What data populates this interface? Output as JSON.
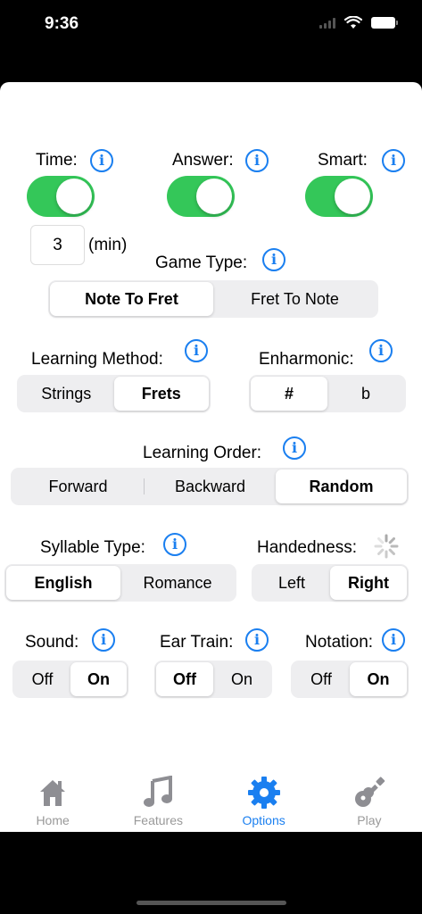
{
  "status": {
    "time": "9:36"
  },
  "options": {
    "time_label": "Time:",
    "answer_label": "Answer:",
    "smart_label": "Smart:",
    "time_value": "3",
    "time_unit": "(min)",
    "game_type_label": "Game Type:",
    "game_type_options": [
      "Note To Fret",
      "Fret To Note"
    ],
    "learning_method_label": "Learning Method:",
    "learning_method_options": [
      "Strings",
      "Frets"
    ],
    "enharmonic_label": "Enharmonic:",
    "enharmonic_options": [
      "#",
      "b"
    ],
    "learning_order_label": "Learning Order:",
    "learning_order_options": [
      "Forward",
      "Backward",
      "Random"
    ],
    "syllable_type_label": "Syllable Type:",
    "syllable_type_options": [
      "English",
      "Romance"
    ],
    "handedness_label": "Handedness:",
    "handedness_options": [
      "Left",
      "Right"
    ],
    "sound_label": "Sound:",
    "ear_train_label": "Ear Train:",
    "notation_label": "Notation:",
    "off_label": "Off",
    "on_label": "On"
  },
  "tabs": [
    {
      "label": "Home",
      "icon": "house-icon"
    },
    {
      "label": "Features",
      "icon": "music-note-icon"
    },
    {
      "label": "Options",
      "icon": "gear-icon"
    },
    {
      "label": "Play",
      "icon": "guitar-icon"
    }
  ],
  "colors": {
    "accent": "#1a7ff0",
    "toggle_on": "#34c759",
    "inactive": "#999999"
  }
}
